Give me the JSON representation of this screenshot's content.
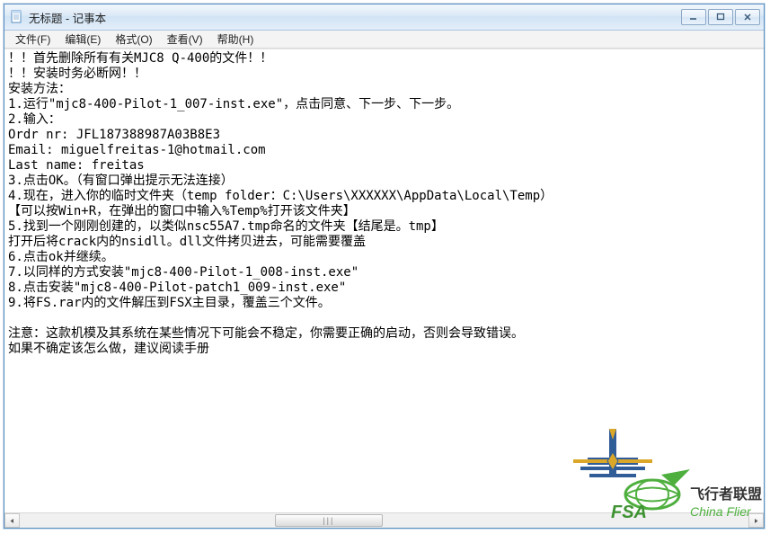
{
  "window": {
    "title": "无标题 - 记事本"
  },
  "menu": {
    "file": "文件(F)",
    "edit": "编辑(E)",
    "format": "格式(O)",
    "view": "查看(V)",
    "help": "帮助(H)"
  },
  "content": {
    "lines": [
      "！！首先删除所有有关MJC8 Q-400的文件！！",
      "！！安装时务必断网！！",
      "安装方法：",
      "1.运行\"mjc8-400-Pilot-1_007-inst.exe\"，点击同意、下一步、下一步。",
      "2.输入：",
      "Ordr nr: JFL187388987A03B8E3",
      "Email: miguelfreitas-1@hotmail.com",
      "Last name: freitas",
      "3.点击OK。（有窗口弹出提示无法连接）",
      "4.现在，进入你的临时文件夹（temp folder：C:\\Users\\XXXXXX\\AppData\\Local\\Temp）",
      "【可以按Win+R，在弹出的窗口中输入%Temp%打开该文件夹】",
      "5.找到一个刚刚创建的，以类似nsc55A7.tmp命名的文件夹【结尾是。tmp】",
      "打开后将crack内的nsidll。dll文件拷贝进去，可能需要覆盖",
      "6.点击ok并继续。",
      "7.以同样的方式安装\"mjc8-400-Pilot-1_008-inst.exe\"",
      "8.点击安装\"mjc8-400-Pilot-patch1_009-inst.exe\"",
      "9.将FS.rar内的文件解压到FSX主目录，覆盖三个文件。",
      "",
      "注意：这款机模及其系统在某些情况下可能会不稳定，你需要正确的启动，否则会导致错误。",
      "如果不确定该怎么做，建议阅读手册"
    ]
  },
  "watermark": {
    "line1": "飞行者联盟",
    "line2": "China Flier"
  },
  "icons": {
    "minimize": "minimize-icon",
    "maximize": "maximize-icon",
    "close": "close-icon",
    "notepad": "notepad-icon"
  }
}
